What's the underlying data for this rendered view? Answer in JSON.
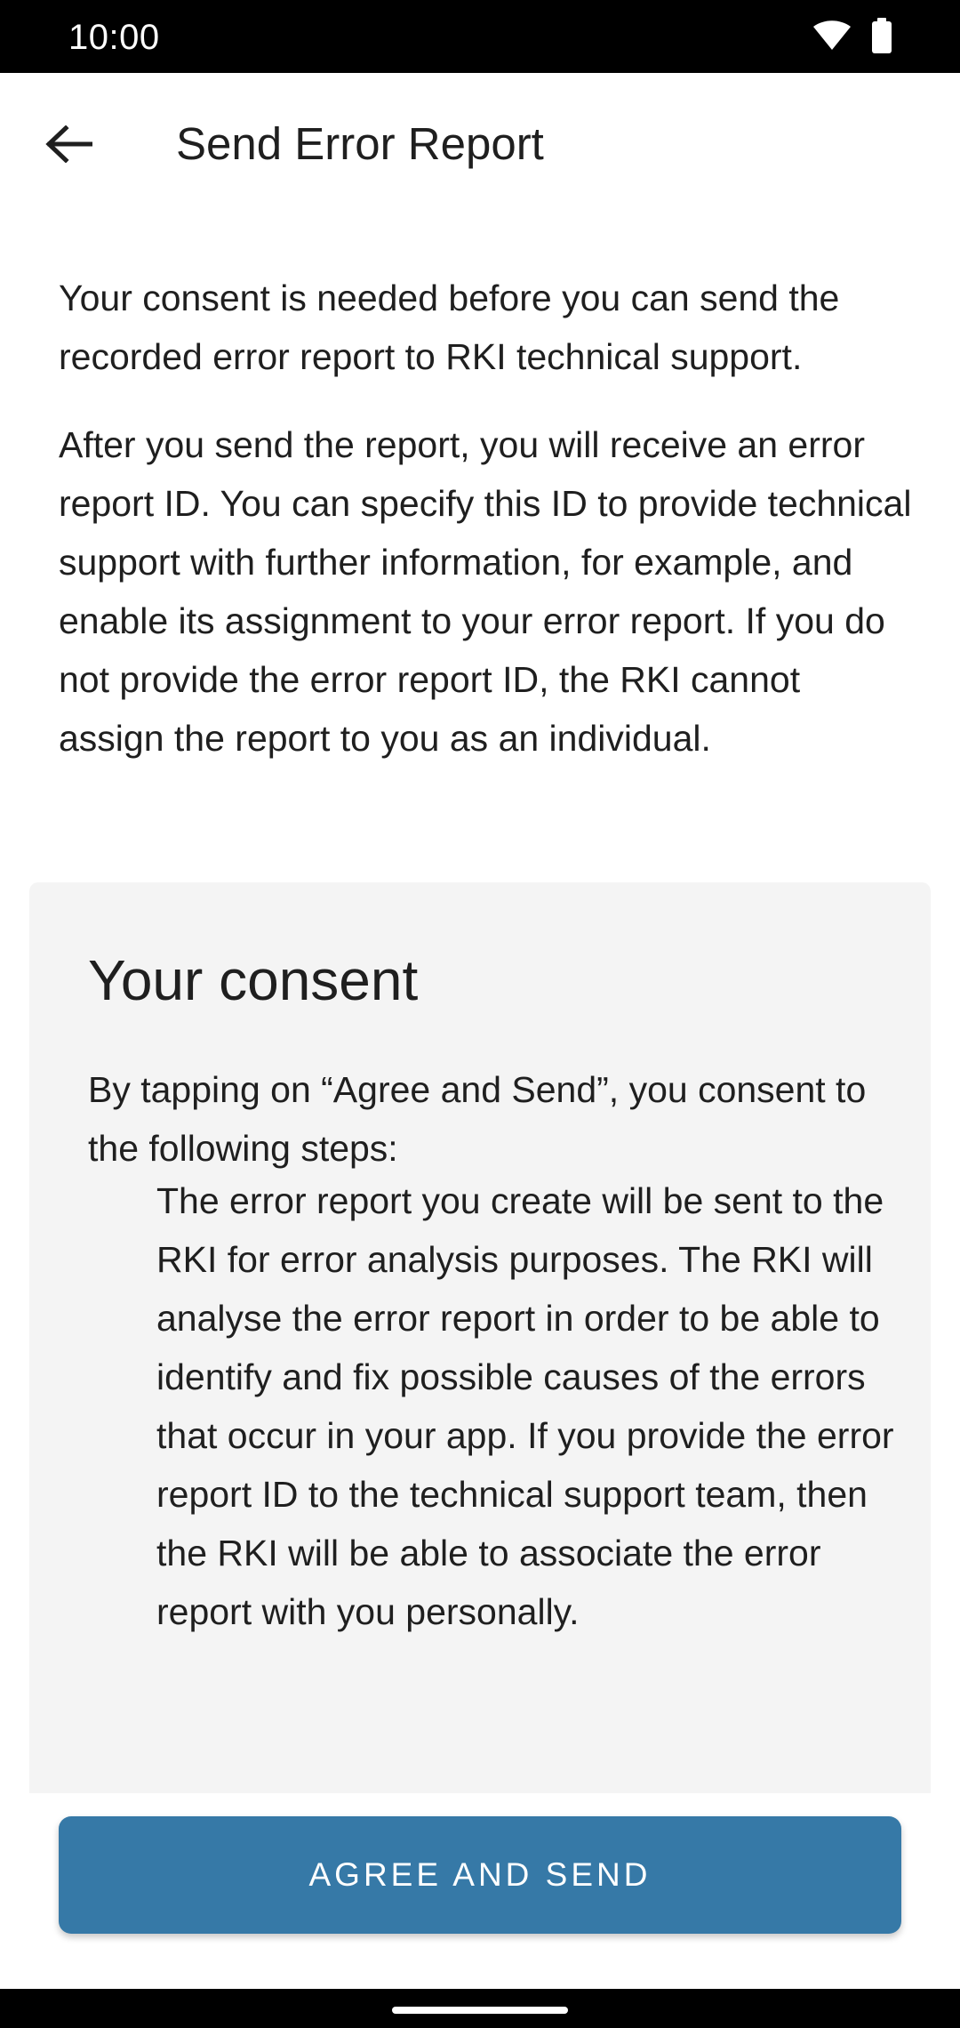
{
  "status_bar": {
    "time": "10:00",
    "icons": [
      "wifi-icon",
      "battery-icon"
    ]
  },
  "toolbar": {
    "back_icon": "arrow-back-icon",
    "title": "Send Error Report"
  },
  "intro": {
    "paragraph_1": "Your consent is needed before you can send the recorded error report to RKI technical support.",
    "paragraph_2": "After you send the report, you will receive an error report ID. You can specify this ID to provide technical support with further information, for example, and enable its assignment to your error report. If you do not provide the error report ID, the RKI cannot assign the report to you as an individual."
  },
  "consent": {
    "title": "Your consent",
    "intro": "By tapping on “Agree and Send”, you consent to the following steps:",
    "step_1": "The error report you create will be sent to the RKI for error analysis purposes. The RKI will analyse the error report in order to be able to identify and fix possible causes of the errors that occur in your app. If you provide the error report ID to the technical support team, then the RKI will be able to associate the error report with you personally."
  },
  "actions": {
    "agree_label": "AGREE AND SEND"
  },
  "colors": {
    "primary_button": "#3679a7",
    "card_background": "#f4f4f4",
    "text": "#1f1f1f"
  }
}
